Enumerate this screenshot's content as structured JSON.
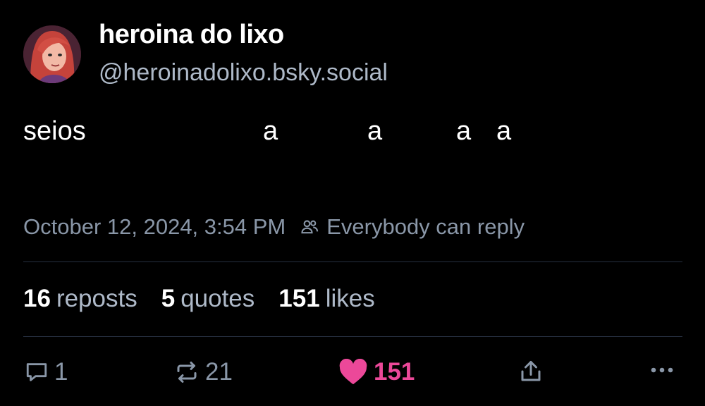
{
  "author": {
    "display_name": "heroina do lixo",
    "handle": "@heroinadolixo.bsky.social",
    "avatar": "avatar-cartoon-redhead"
  },
  "post": {
    "text_start": "seios",
    "fragments": [
      "a",
      "a",
      "a",
      "a"
    ],
    "timestamp": "October 12, 2024, 3:54 PM",
    "reply_setting": "Everybody can reply"
  },
  "stats": {
    "reposts_count": "16",
    "reposts_label": "reposts",
    "quotes_count": "5",
    "quotes_label": "quotes",
    "likes_count": "151",
    "likes_label": "likes"
  },
  "actions": {
    "reply_count": "1",
    "repost_count": "21",
    "like_count": "151",
    "like_color": "#ec4899",
    "icons": [
      "reply-icon",
      "repost-icon",
      "heart-icon",
      "share-icon",
      "more-icon"
    ]
  }
}
